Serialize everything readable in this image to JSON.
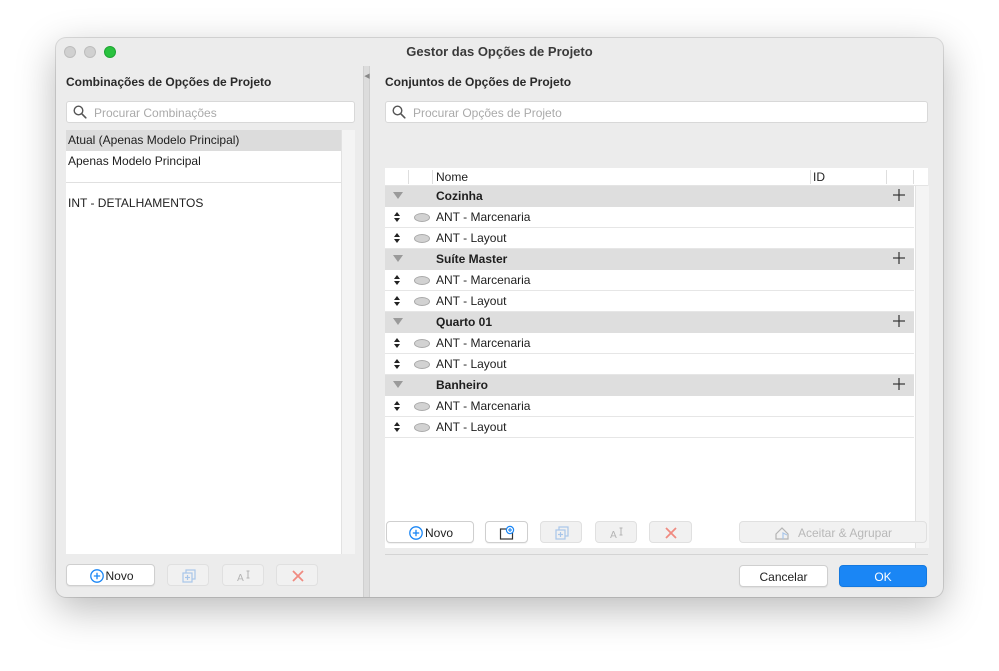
{
  "window": {
    "title": "Gestor das Opções de Projeto",
    "accent_color": "#1a86f5"
  },
  "combinations": {
    "title": "Combinações de Opções de Projeto",
    "search_placeholder": "Procurar Combinações",
    "items": [
      {
        "label": "Atual (Apenas Modelo Principal)",
        "selected": true
      },
      {
        "label": "Apenas Modelo Principal",
        "selected": false
      },
      {
        "label": "INT - DETALHAMENTOS",
        "selected": false
      }
    ],
    "buttons": {
      "new_label": "Novo"
    }
  },
  "option_sets": {
    "title": "Conjuntos de Opções de Projeto",
    "search_placeholder": "Procurar Opções de Projeto",
    "columns": {
      "name": "Nome",
      "id": "ID"
    },
    "groups": [
      {
        "name": "Cozinha",
        "options": [
          "ANT - Marcenaria",
          "ANT - Layout"
        ]
      },
      {
        "name": "Suíte Master",
        "options": [
          "ANT - Marcenaria",
          "ANT - Layout"
        ]
      },
      {
        "name": "Quarto 01",
        "options": [
          "ANT - Marcenaria",
          "ANT - Layout"
        ]
      },
      {
        "name": "Banheiro",
        "options": [
          "ANT - Marcenaria",
          "ANT - Layout"
        ]
      }
    ],
    "buttons": {
      "new_label": "Novo",
      "accept_label": "Aceitar  & Agrupar"
    }
  },
  "dialog": {
    "cancel_label": "Cancelar",
    "ok_label": "OK"
  },
  "icons": {
    "search": "search-icon",
    "add_circle": "plus-circle-icon",
    "new_folder": "new-group-icon",
    "duplicate": "duplicate-icon",
    "rename": "rename-icon",
    "delete": "delete-x-icon",
    "plus": "plus-icon",
    "disclosure": "disclosure-triangle-icon",
    "reorder": "reorder-arrows-icon",
    "visibility": "eye-icon",
    "accept_house": "accept-house-icon"
  }
}
